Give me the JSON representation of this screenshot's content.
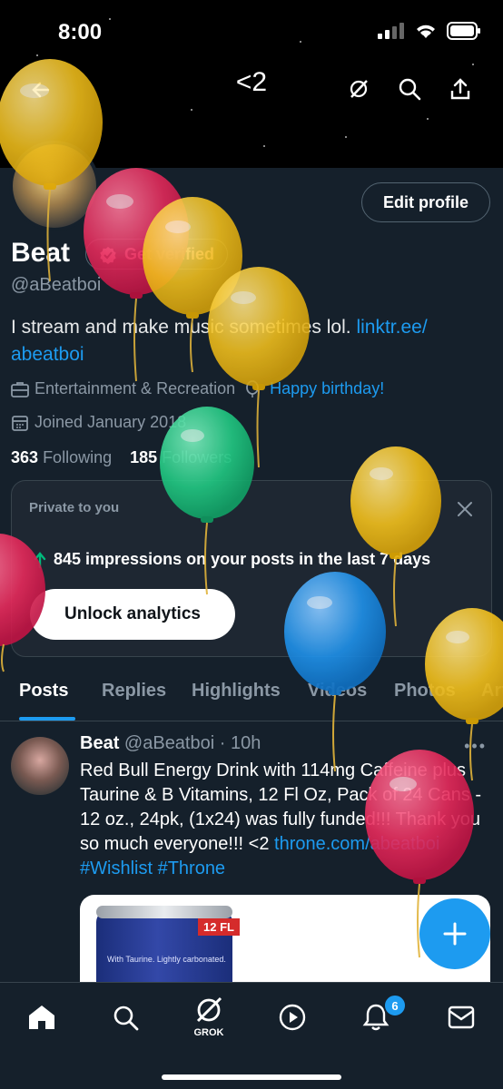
{
  "status_bar": {
    "time": "8:00"
  },
  "top_bar": {
    "title": "<2"
  },
  "profile": {
    "edit_label": "Edit profile",
    "name": "Beat",
    "verify_label": "Get verified",
    "handle": "@aBeatboi",
    "bio_text": "I stream and make music sometimes lol. ",
    "bio_link": "linktr.ee/​abeatboi",
    "category": "Entertainment & Recreation",
    "birthday": "Happy birthday!",
    "joined": "Joined January 2018",
    "following_count": "363",
    "following_label": "Following",
    "followers_count": "185",
    "followers_label": "Followers"
  },
  "analytics_card": {
    "label": "Private to you",
    "text": "845 impressions on your posts in the last 7 days",
    "button_label": "Unlock analytics"
  },
  "tabs": [
    "Posts",
    "Replies",
    "Highlights",
    "Videos",
    "Photos",
    "Articles"
  ],
  "post": {
    "author": "Beat",
    "handle_time": "@aBeatboi · 10h",
    "text": "Red Bull Energy Drink with 114mg Caffeine plus Taurine & B Vitamins, 12 Fl Oz, Pack of 24 Cans - 12 oz., 24pk, (1x24) was fully funded!!! Thank you so much everyone!!! <2 ",
    "link": "throne.com/​abeatboi",
    "hashtags": " #Wishlist #Throne",
    "media_label": "12 FL",
    "media_text": "With Taurine. Lightly carbonated."
  },
  "bottom_nav": {
    "items": [
      "home-icon",
      "search-icon",
      "grok-icon",
      "video-icon",
      "notifications-icon",
      "messages-icon"
    ],
    "grok_label": "GROK",
    "notifications_badge": "6"
  },
  "colors": {
    "background": "#15202b",
    "accent": "#1d9bf0",
    "balloon_yellow": "#f5c518",
    "balloon_pink": "#e8295a",
    "balloon_green": "#22c983",
    "balloon_blue": "#1f8fe6"
  }
}
